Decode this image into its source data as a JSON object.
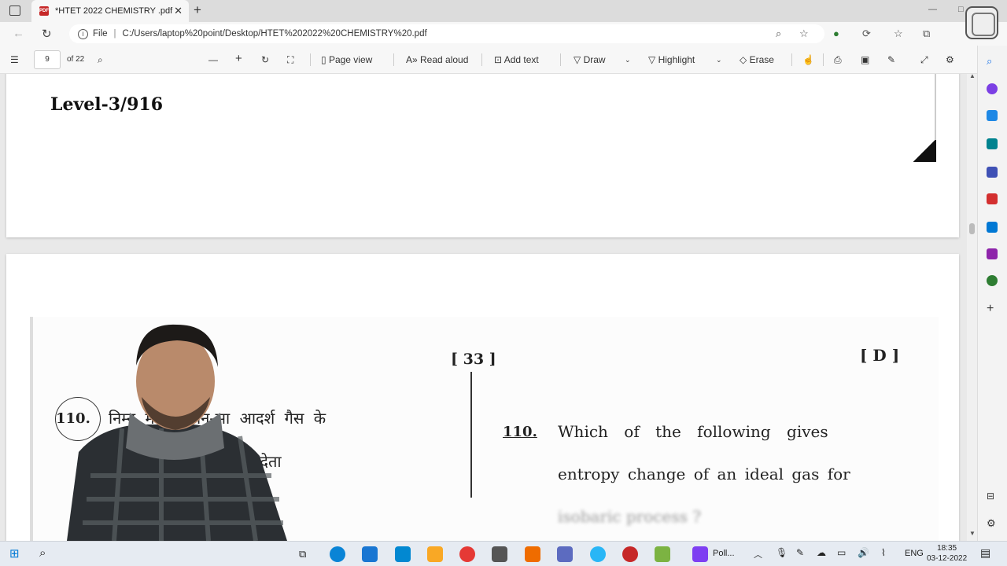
{
  "browser": {
    "tab_title": "*HTET 2022 CHEMISTRY .pdf",
    "url_prefix": "File",
    "url": "C:/Users/laptop%20point/Desktop/HTET%202022%20CHEMISTRY%20.pdf"
  },
  "pdf_toolbar": {
    "page_current": "9",
    "page_total": "of 22",
    "page_view": "Page view",
    "read_aloud": "Read aloud",
    "add_text": "Add text",
    "draw": "Draw",
    "highlight": "Highlight",
    "erase": "Erase"
  },
  "document": {
    "header_code": "Level-3/916",
    "page_number": "[ 33 ]",
    "set_label": "[ D ]",
    "question_number_hi": "110.",
    "question_hi_line1": "निम्न में से कौन-सा आदर्श गैस के",
    "question_hi_line2": "लिए में एंट्रापी परिवर्तन देता",
    "question_number_en": "110.",
    "question_en_line1": "Which of the following gives",
    "question_en_line2": "entropy change of an ideal gas for",
    "question_en_line3": "isobaric process ?"
  },
  "taskbar": {
    "running_app": "Poll...",
    "language": "ENG",
    "time": "18:35",
    "date": "03-12-2022"
  },
  "colors": {
    "pdf_icon": "#c62828",
    "page_bg": "#ffffff",
    "viewer_bg": "#e9e9e9",
    "taskbar_bg": "#e6ebf2"
  }
}
